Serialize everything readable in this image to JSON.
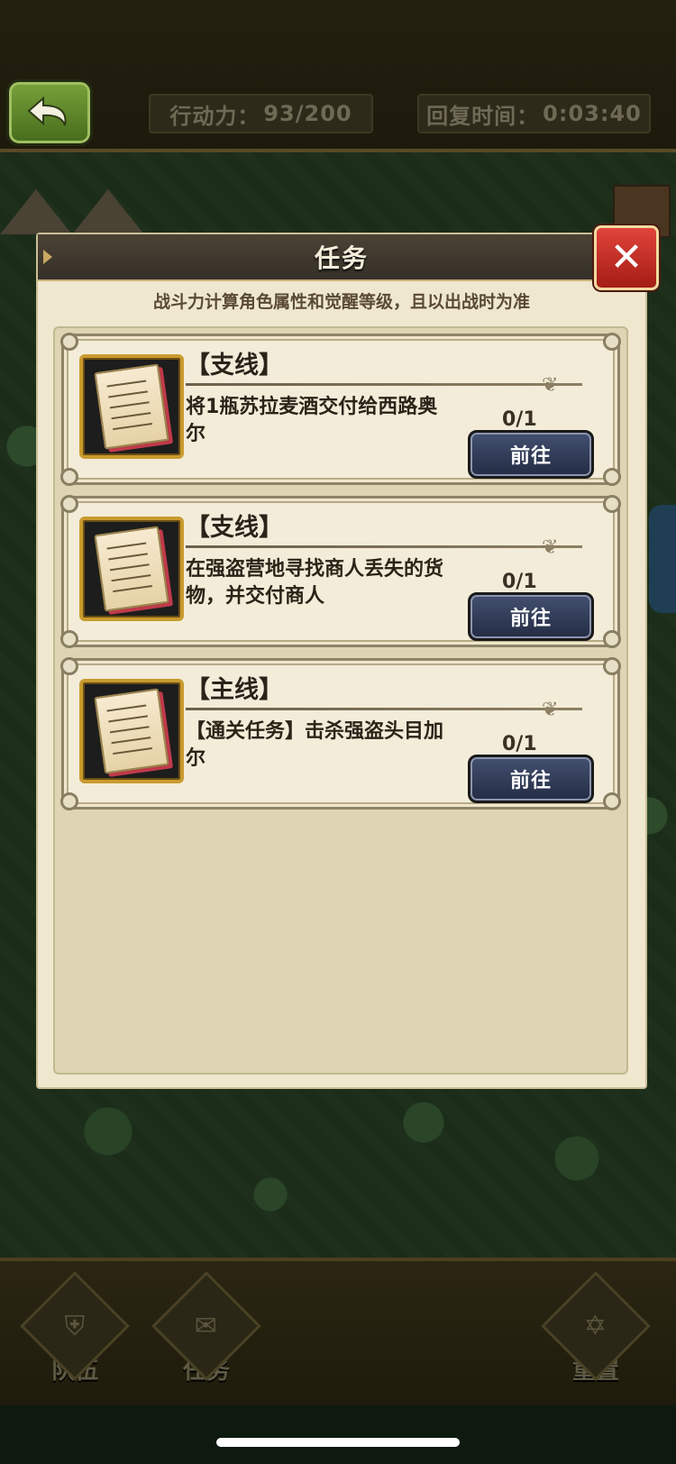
{
  "top_bar": {
    "stamina_label": "行动力：",
    "stamina_value": "93/200",
    "recovery_label": "回复时间：",
    "recovery_value": "0:03:40"
  },
  "modal": {
    "title": "任务",
    "subtitle": "战斗力计算角色属性和觉醒等级，且以出战时为准",
    "close_icon": "close-icon"
  },
  "quests": [
    {
      "type": "【支线】",
      "description": "将1瓶苏拉麦酒交付给西路奥尔",
      "progress": "0/1",
      "button_label": "前往"
    },
    {
      "type": "【支线】",
      "description": "在强盗营地寻找商人丢失的货物，并交付商人",
      "progress": "0/1",
      "button_label": "前往"
    },
    {
      "type": "【主线】",
      "description": "【通关任务】击杀强盗头目加尔",
      "progress": "0/1",
      "button_label": "前往"
    }
  ],
  "bottom_nav": {
    "team_label": "队伍",
    "quest_label": "任务",
    "reset_label": "重置"
  },
  "colors": {
    "modal_bg": "#efe8cf",
    "header_bg": "#3d362d",
    "close_button": "#d23a30",
    "go_button": "#2f3a55",
    "icon_frame": "#c99b2e"
  }
}
